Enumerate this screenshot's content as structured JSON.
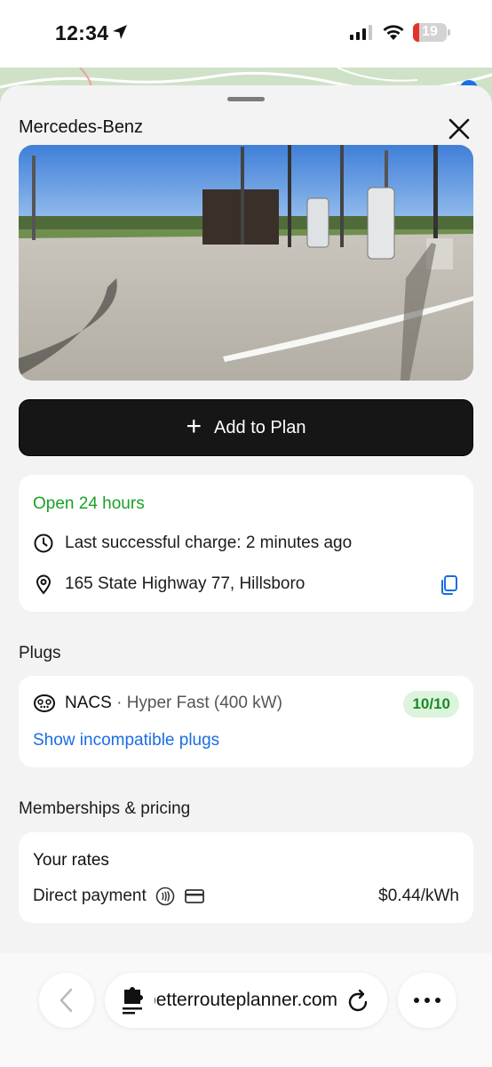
{
  "status_bar": {
    "time": "12:34",
    "battery": "19",
    "icons": [
      "location-arrow-icon",
      "cellular-signal-icon",
      "wifi-icon",
      "battery-icon"
    ]
  },
  "station": {
    "name": "Mercedes-Benz",
    "photo_desc": "charging-station-photo"
  },
  "actions": {
    "add_to_plan": "Add to Plan"
  },
  "info": {
    "hours": "Open 24 hours",
    "last_charge": "Last successful charge: 2 minutes ago",
    "address": "165 State Highway 77, Hillsboro"
  },
  "plugs": {
    "section_title": "Plugs",
    "items": [
      {
        "name": "NACS",
        "separator": "·",
        "detail": "Hyper Fast (400 kW)",
        "availability": "10/10"
      }
    ],
    "incompatible_link": "Show incompatible plugs"
  },
  "pricing": {
    "section_title": "Memberships & pricing",
    "rates_label": "Your rates",
    "payment_method": "Direct payment",
    "price": "$0.44/kWh"
  },
  "browser": {
    "url": "abetterrouteplanner.com"
  },
  "colors": {
    "open_green": "#18a225",
    "link_blue": "#1a6ee0",
    "badge_bg": "#dcf3dc",
    "button_dark": "#161616"
  }
}
